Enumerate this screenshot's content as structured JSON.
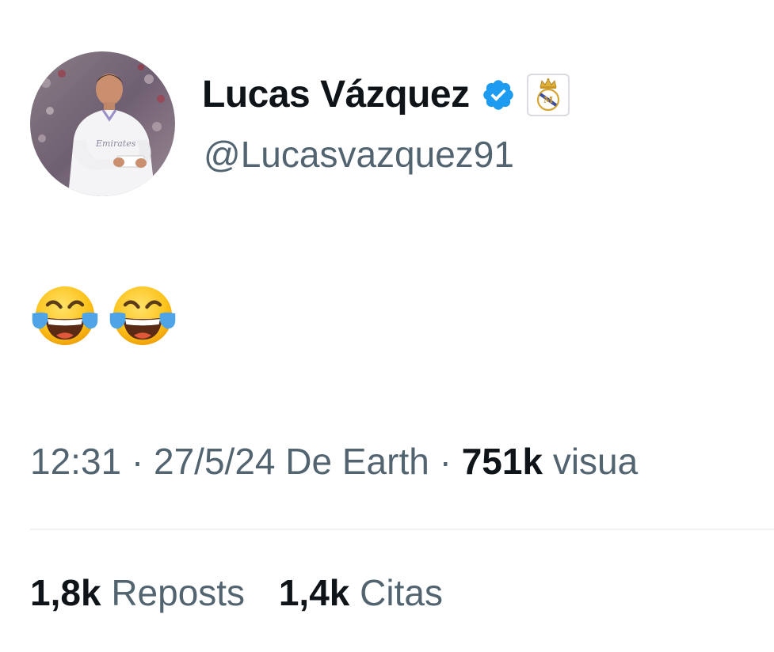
{
  "author": {
    "display_name": "Lucas Vázquez",
    "handle": "@Lucasvazquez91",
    "verified": true,
    "affiliate_badge_icon": "real-madrid-crest-icon"
  },
  "tweet": {
    "text": "😂😂",
    "emoji_icons": [
      "face-with-tears-of-joy-icon",
      "face-with-tears-of-joy-icon"
    ]
  },
  "meta": {
    "time": "12:31",
    "separator": "·",
    "date": "27/5/24",
    "source": "De Earth",
    "views_count": "751k",
    "views_label": "visua"
  },
  "stats": {
    "reposts_count": "1,8k",
    "reposts_label": "Reposts",
    "quotes_count": "1,4k",
    "quotes_label": "Citas"
  },
  "colors": {
    "primary_text": "#0f1419",
    "secondary_text": "#536471",
    "verified_blue": "#1d9bf0",
    "divider": "#eff3f4"
  }
}
